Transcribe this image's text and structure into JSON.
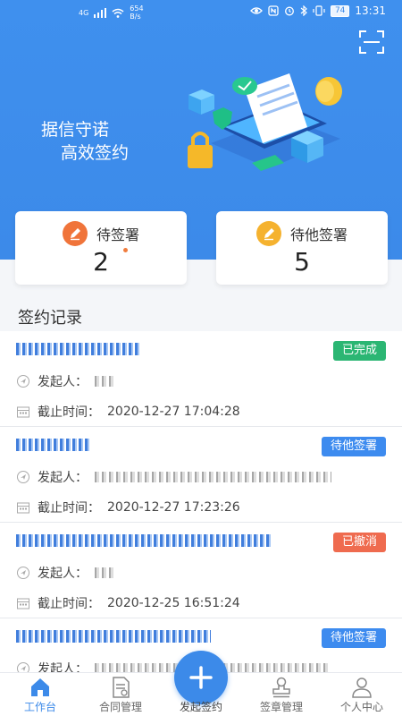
{
  "status_bar": {
    "network": "4G",
    "speed": "654",
    "speed_unit": "B/s",
    "battery": "74",
    "time": "13:31"
  },
  "hero": {
    "line1": "据信守诺",
    "line2": "高效签约"
  },
  "stats": {
    "pending_mine": {
      "label": "待签署",
      "count": "2"
    },
    "pending_others": {
      "label": "待他签署",
      "count": "5"
    }
  },
  "records_section": {
    "title": "签约记录"
  },
  "record_labels": {
    "initiator": "发起人：",
    "deadline": "截止时间："
  },
  "records": [
    {
      "status": "已完成",
      "deadline": "2020-12-27 17:04:28"
    },
    {
      "status": "待他签署",
      "deadline": "2020-12-27 17:23:26"
    },
    {
      "status": "已撤消",
      "deadline": "2020-12-25 16:51:24"
    },
    {
      "status": "待他签署",
      "deadline": ""
    }
  ],
  "nav": {
    "workbench": "工作台",
    "contracts": "合同管理",
    "initiate": "发起签约",
    "seals": "签章管理",
    "profile": "个人中心"
  },
  "colors": {
    "primary": "#3c8ae9",
    "completed": "#2bb673",
    "revoked": "#ef6b4f",
    "stat_orange": "#f0743a",
    "stat_yellow": "#f5b22f"
  }
}
